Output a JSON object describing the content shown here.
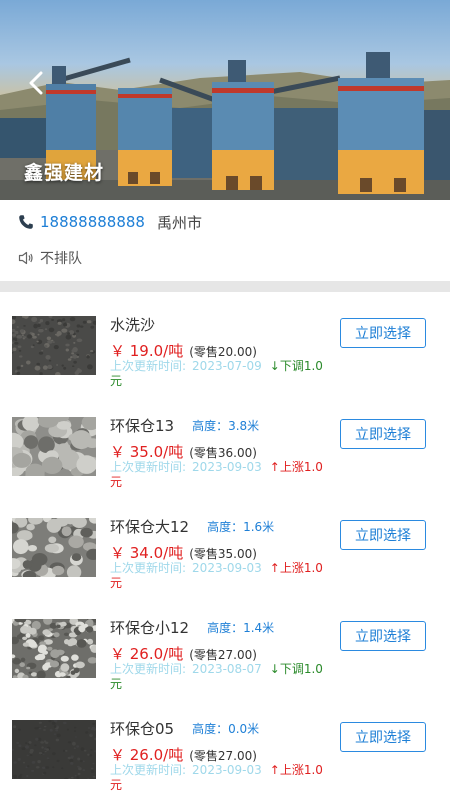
{
  "header": {
    "shop_name": "鑫强建材",
    "back_icon": "chevron-left-icon"
  },
  "contact": {
    "phone": "18888888888",
    "city": "禹州市",
    "phone_icon": "phone-icon"
  },
  "queue": {
    "status": "不排队",
    "icon": "speaker-icon"
  },
  "colors": {
    "accent": "#1e7fd6",
    "price": "#e02020",
    "down": "#2a8a2a",
    "update_text": "#9fd8ea"
  },
  "products": [
    {
      "name": "水洗沙",
      "height_label": "",
      "price": "￥ 19.0/吨",
      "retail": "(零售20.00)",
      "update_label": "上次更新时间:",
      "update_date": "2023-07-09",
      "change": "↓下调1.0元",
      "direction": "down",
      "button": "立即选择",
      "thumb": "sand"
    },
    {
      "name": "环保仓13",
      "height_label": "高度：3.8米",
      "price": "￥ 35.0/吨",
      "retail": "(零售36.00)",
      "update_label": "上次更新时间:",
      "update_date": "2023-09-03",
      "change": "↑上涨1.0元",
      "direction": "up",
      "button": "立即选择",
      "thumb": "stone-large"
    },
    {
      "name": "环保仓大12",
      "height_label": "高度：1.6米",
      "price": "￥ 34.0/吨",
      "retail": "(零售35.00)",
      "update_label": "上次更新时间:",
      "update_date": "2023-09-03",
      "change": "↑上涨1.0元",
      "direction": "up",
      "button": "立即选择",
      "thumb": "stone-medium"
    },
    {
      "name": "环保仓小12",
      "height_label": "高度：1.4米",
      "price": "￥ 26.0/吨",
      "retail": "(零售27.00)",
      "update_label": "上次更新时间:",
      "update_date": "2023-08-07",
      "change": "↓下调1.0元",
      "direction": "down",
      "button": "立即选择",
      "thumb": "stone-small"
    },
    {
      "name": "环保仓05",
      "height_label": "高度：0.0米",
      "price": "￥ 26.0/吨",
      "retail": "(零售27.00)",
      "update_label": "上次更新时间:",
      "update_date": "2023-09-03",
      "change": "↑上涨1.0元",
      "direction": "up",
      "button": "立即选择",
      "thumb": "dust"
    }
  ]
}
